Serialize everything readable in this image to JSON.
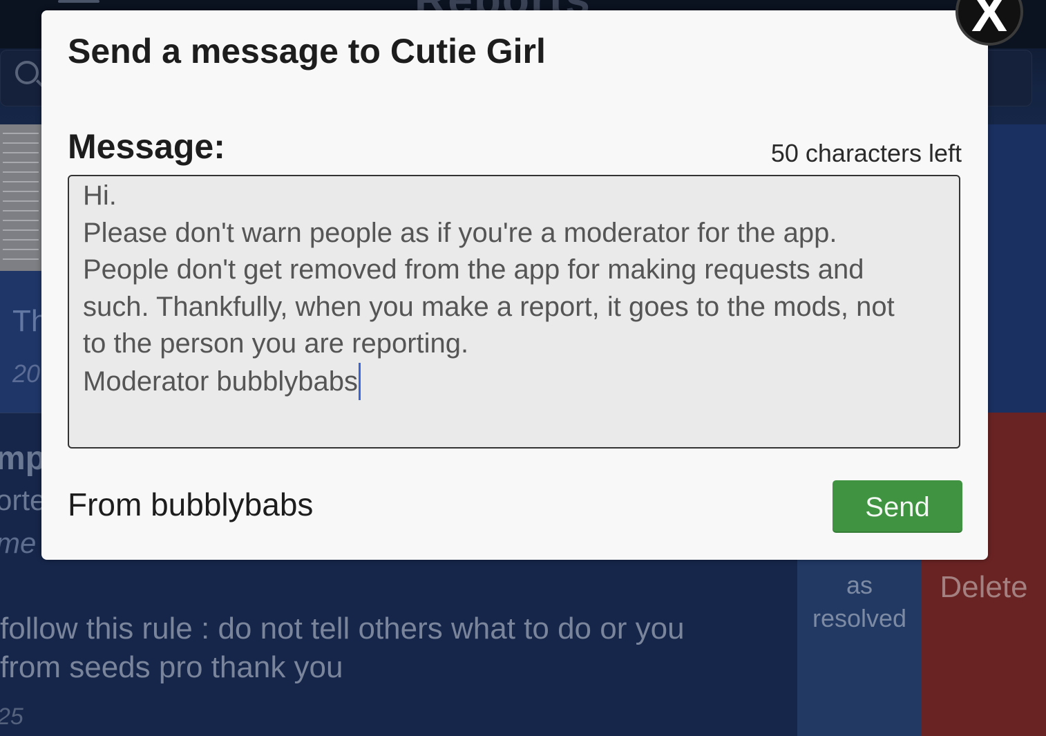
{
  "background": {
    "page_title": "Reports",
    "card": {
      "title_fragment": "Th",
      "date_fragment": "20",
      "reported_user_fragment": "mp",
      "reported_label_fragment": "orte",
      "comment_fragment": "me"
    },
    "rule_text_line1": "follow this rule : do not tell others what to do or you",
    "rule_text_line2": " from seeds pro thank you",
    "date_fragment_2": "25",
    "resolve_label_lines": [
      "as",
      "resolved"
    ],
    "delete_label": "Delete"
  },
  "modal": {
    "close_glyph": "X",
    "title": "Send a message to Cutie Girl",
    "message_label": "Message:",
    "chars_left": "50 characters left",
    "message_lines": [
      "Hi.",
      "Please don't warn people as if you're a moderator for the app.",
      "People don't get removed from the app for making requests and",
      "such. Thankfully, when you make a report, it goes to the mods, not",
      "to the person you are reporting.",
      "Moderator bubblybabs"
    ],
    "from": "From bubblybabs",
    "send_label": "Send"
  },
  "colors": {
    "send_button": "#3f9341",
    "delete_panel": "#6a2323",
    "resolve_panel": "#213963",
    "caret": "#3a65d8"
  },
  "icons": [
    "search-icon",
    "close-icon",
    "text-caret"
  ]
}
